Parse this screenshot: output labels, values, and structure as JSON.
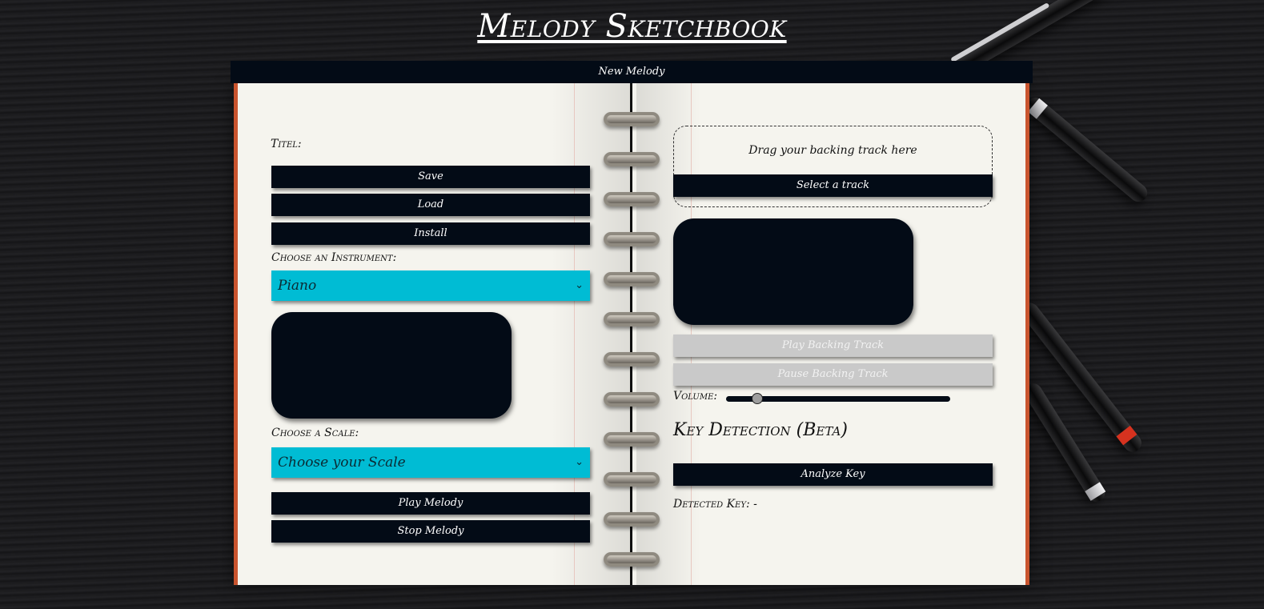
{
  "app": {
    "title": "Melody Sketchbook"
  },
  "top_bar": {
    "new_melody_label": "New Melody"
  },
  "left_page": {
    "title_label": "Titel:",
    "buttons": {
      "save": "Save",
      "load": "Load",
      "install": "Install"
    },
    "instrument": {
      "label": "Choose an Instrument:",
      "selected": "Piano"
    },
    "scale": {
      "label": "Choose a Scale:",
      "selected": "Choose your Scale"
    },
    "play_melody": "Play Melody",
    "stop_melody": "Stop Melody"
  },
  "right_page": {
    "drop_zone_text": "Drag your backing track here",
    "select_track": "Select a track",
    "play_backing": "Play Backing Track",
    "pause_backing": "Pause Backing Track",
    "volume_label": "Volume:",
    "volume_level": 0.12,
    "key_heading": "Key Detection (Beta)",
    "analyze_key": "Analyze Key",
    "detected_key": "Detected Key: -"
  },
  "colors": {
    "dark": "#030b16",
    "select_bg": "#00bcd4",
    "disabled_bg": "#c9c9c9",
    "paper": "#f5f4ee",
    "page_edge": "#c9542e"
  }
}
